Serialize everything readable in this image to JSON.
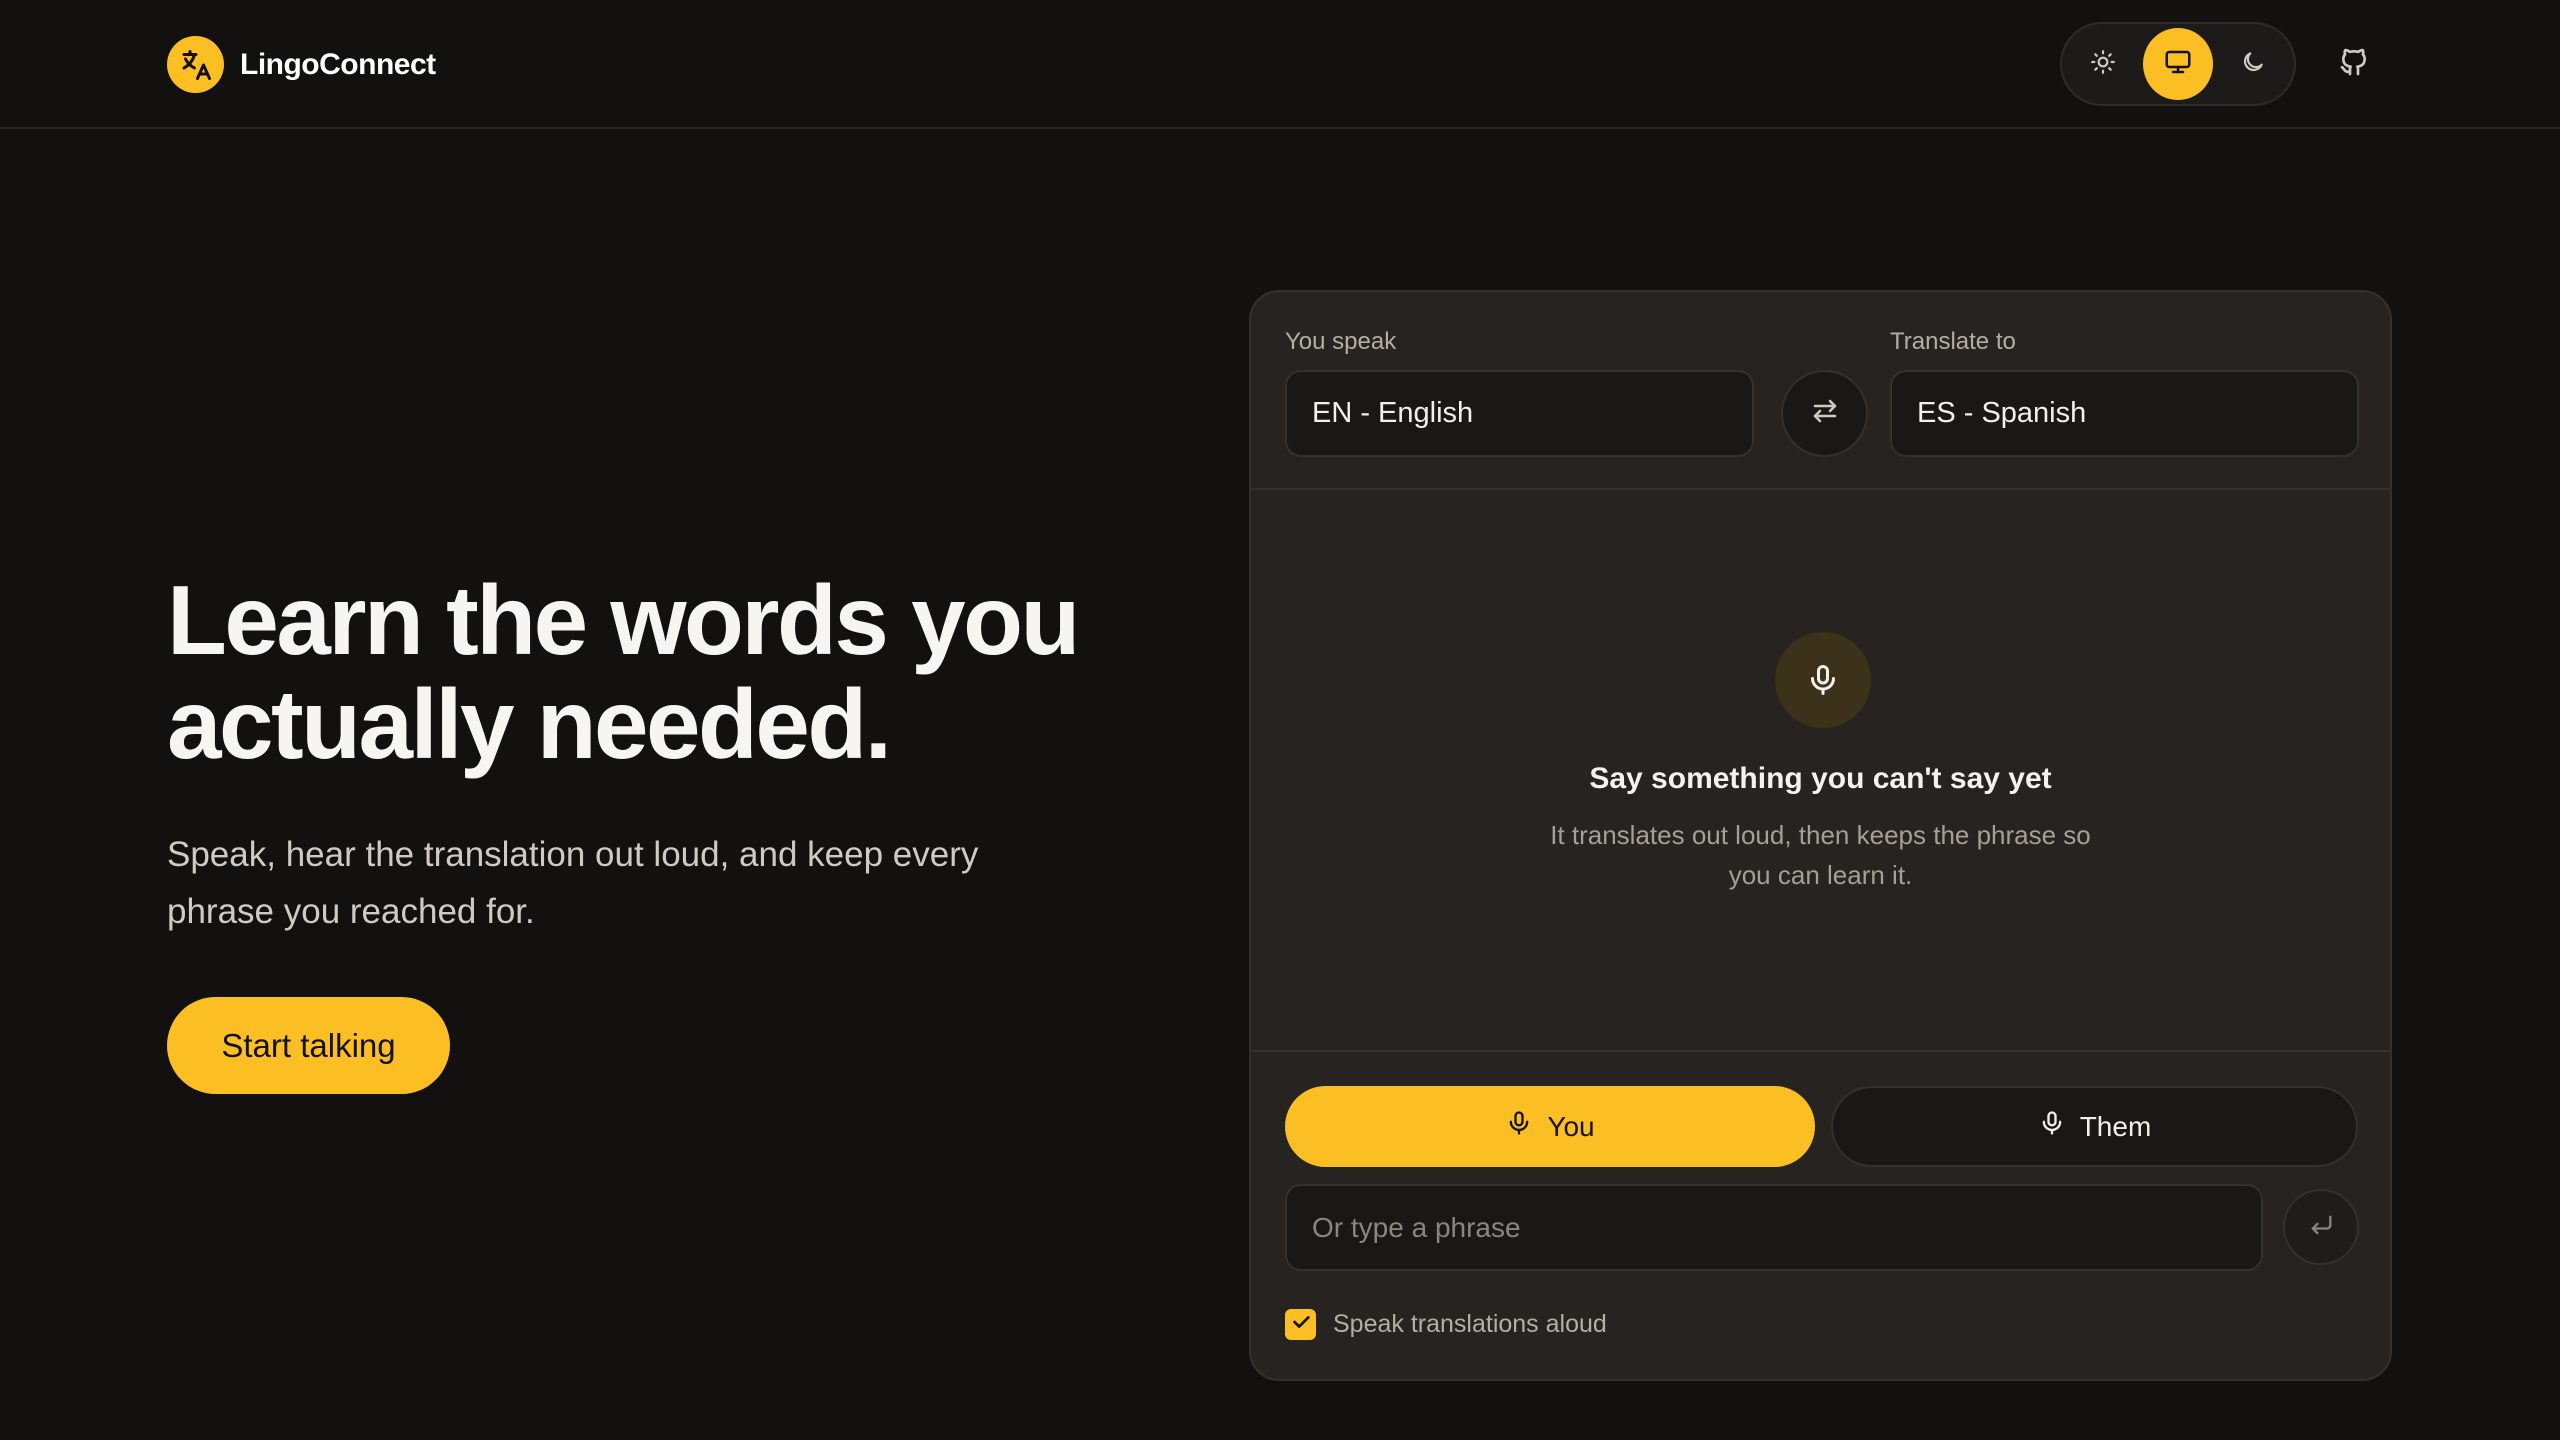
{
  "brand": {
    "name": "LingoConnect",
    "logo_icon": "translate-icon"
  },
  "theme_switch": {
    "options": [
      {
        "name": "light",
        "icon": "sun-icon"
      },
      {
        "name": "system",
        "icon": "monitor-icon",
        "selected": true
      },
      {
        "name": "dark",
        "icon": "moon-icon"
      }
    ]
  },
  "github_icon": "github-icon",
  "hero": {
    "title_line1": "Learn the words you",
    "title_line2": "actually needed.",
    "subtitle_line1": "Speak, hear the translation out loud, and keep every",
    "subtitle_line2": "phrase you reached for.",
    "cta_label": "Start talking"
  },
  "translator": {
    "source_label": "You speak",
    "source_value": "EN - English",
    "target_label": "Translate to",
    "target_value": "ES - Spanish",
    "empty_title": "Say something you can't say yet",
    "empty_desc_line1": "It translates out loud, then keeps the phrase so",
    "empty_desc_line2": "you can learn it.",
    "you_label": "You",
    "them_label": "Them",
    "input_placeholder": "Or type a phrase",
    "speak_aloud_label": "Speak translations aloud",
    "speak_aloud_checked": true
  },
  "colors": {
    "accent": "#fbbf24",
    "background": "#121110",
    "panel": "#262320"
  }
}
